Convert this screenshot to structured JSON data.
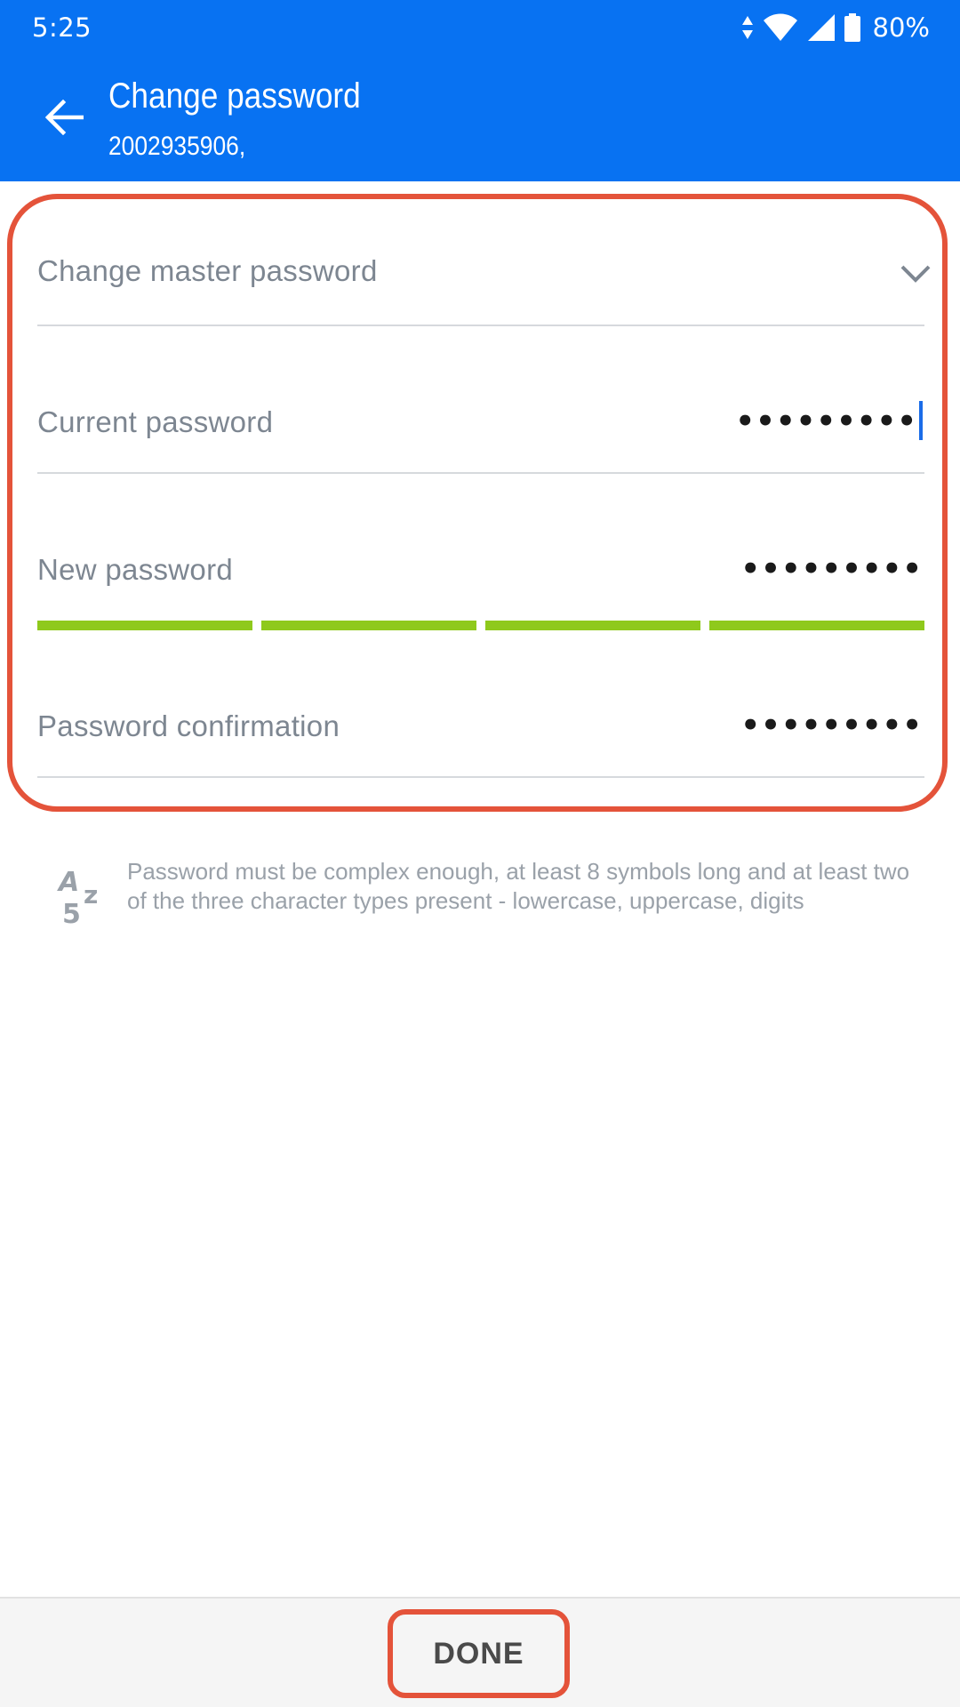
{
  "status_bar": {
    "time": "5:25",
    "battery": "80%",
    "icons": [
      "data-arrows-icon",
      "wifi-icon",
      "cell-signal-icon",
      "battery-icon"
    ]
  },
  "app_bar": {
    "title": "Change password",
    "subtitle": "2002935906,",
    "back_icon": "arrow-left-icon"
  },
  "form": {
    "master": {
      "label": "Change master password",
      "icon": "chevron-down-icon"
    },
    "current_password": {
      "label": "Current password",
      "value": "•••••••••",
      "focused": true
    },
    "new_password": {
      "label": "New password",
      "value": "•••••••••",
      "strength_segments_filled": 4,
      "strength_segments_total": 4
    },
    "confirmation": {
      "label": "Password confirmation",
      "value": "•••••••••"
    }
  },
  "hint": {
    "icon": "az5-complexity-icon",
    "text": "Password must be complex enough, at least 8 symbols long and at least two of the three character types present - lowercase, uppercase, digits"
  },
  "footer": {
    "done_label": "DONE"
  },
  "colors": {
    "primary": "#0872F2",
    "highlight": "#E4533A",
    "strength": "#8FC91C",
    "caret": "#1A6CE8"
  }
}
